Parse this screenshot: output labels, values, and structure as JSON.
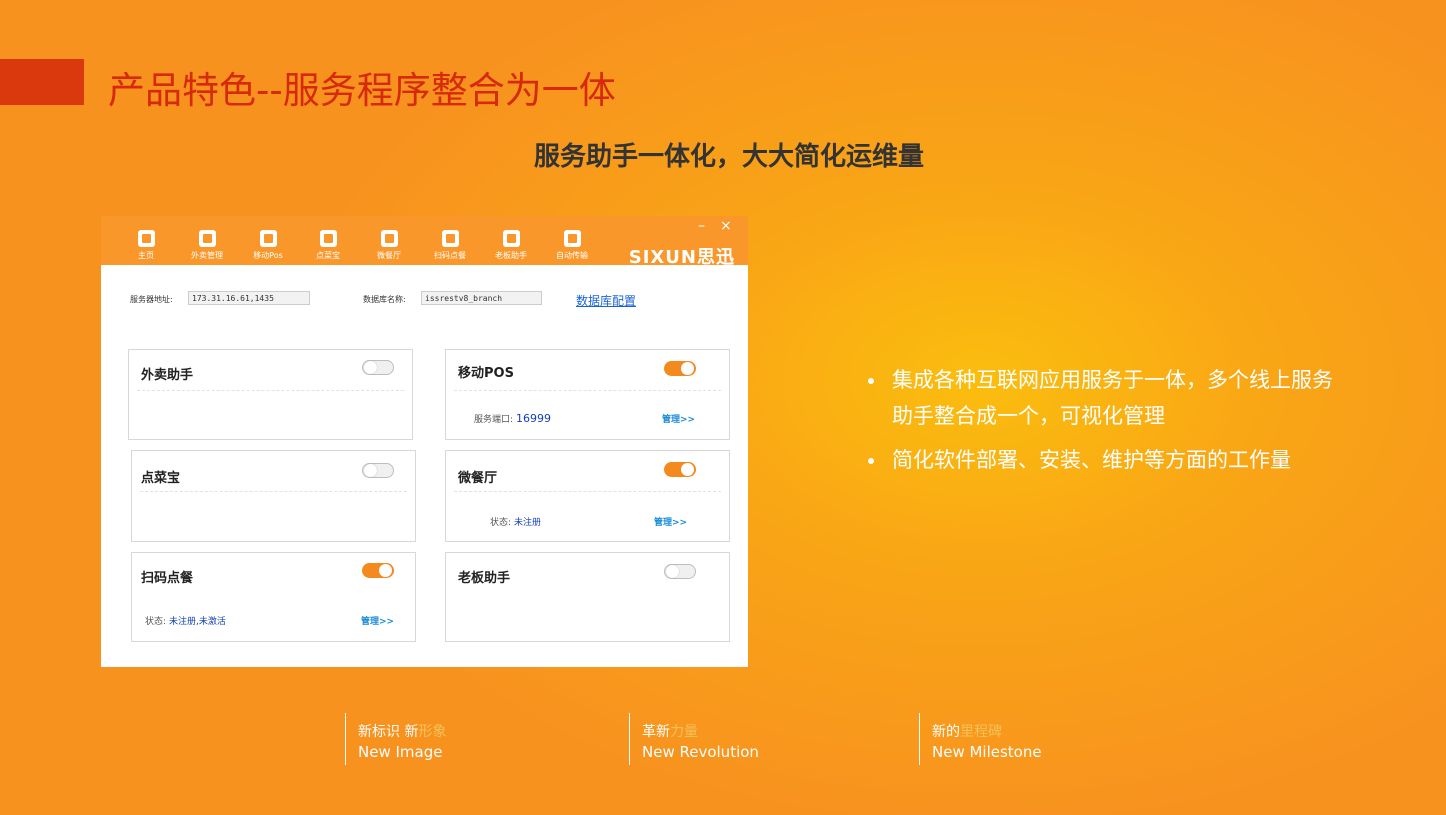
{
  "slide": {
    "title": "产品特色--服务程序整合为一体",
    "subtitle": "服务助手一体化，大大简化运维量"
  },
  "app": {
    "toolbar": [
      {
        "label": "主页",
        "icon": "home-icon"
      },
      {
        "label": "外卖管理",
        "icon": "fork-knife-icon"
      },
      {
        "label": "移动Pos",
        "icon": "mobile-icon"
      },
      {
        "label": "点菜宝",
        "icon": "device-icon"
      },
      {
        "label": "微餐厅",
        "icon": "restaurant-icon"
      },
      {
        "label": "扫码点餐",
        "icon": "qr-code-icon"
      },
      {
        "label": "老板助手",
        "icon": "boss-icon"
      },
      {
        "label": "自动传输",
        "icon": "transfer-icon"
      }
    ],
    "window": {
      "minimize": "–",
      "close": "×"
    },
    "brand": "SIXUN思迅",
    "config": {
      "server_label": "服务器地址:",
      "server_value": "173.31.16.61,1435",
      "db_label": "数据库名称:",
      "db_value": "issrestv8_branch",
      "db_config_link": "数据库配置"
    },
    "cards": [
      {
        "title": "外卖助手",
        "enabled": false
      },
      {
        "title": "移动POS",
        "enabled": true,
        "meta_label": "服务端口:",
        "meta_value": "16999",
        "manage": "管理>>"
      },
      {
        "title": "点菜宝",
        "enabled": false
      },
      {
        "title": "微餐厅",
        "enabled": true,
        "meta_label": "状态:",
        "meta_value": "未注册",
        "manage": "管理>>"
      },
      {
        "title": "扫码点餐",
        "enabled": true,
        "meta_label": "状态:",
        "meta_value": "未注册,未激活",
        "manage": "管理>>"
      },
      {
        "title": "老板助手",
        "enabled": false
      }
    ]
  },
  "bullets": [
    "集成各种互联网应用服务于一体，多个线上服务助手整合成一个，可视化管理",
    "简化软件部署、安装、维护等方面的工作量"
  ],
  "footer": [
    {
      "cn_a": "新标识 新",
      "cn_b": "形象",
      "en": "New Image"
    },
    {
      "cn_a": "革新",
      "cn_b": "力量",
      "en": "New Revolution"
    },
    {
      "cn_a": "新的",
      "cn_b": "里程碑",
      "en": "New Milestone"
    }
  ],
  "colors": {
    "accent_red": "#d9390c",
    "title_red": "#d7290c",
    "app_orange": "#f9972a",
    "toggle_on": "#f48a1e",
    "link_blue": "#1a63d6"
  }
}
